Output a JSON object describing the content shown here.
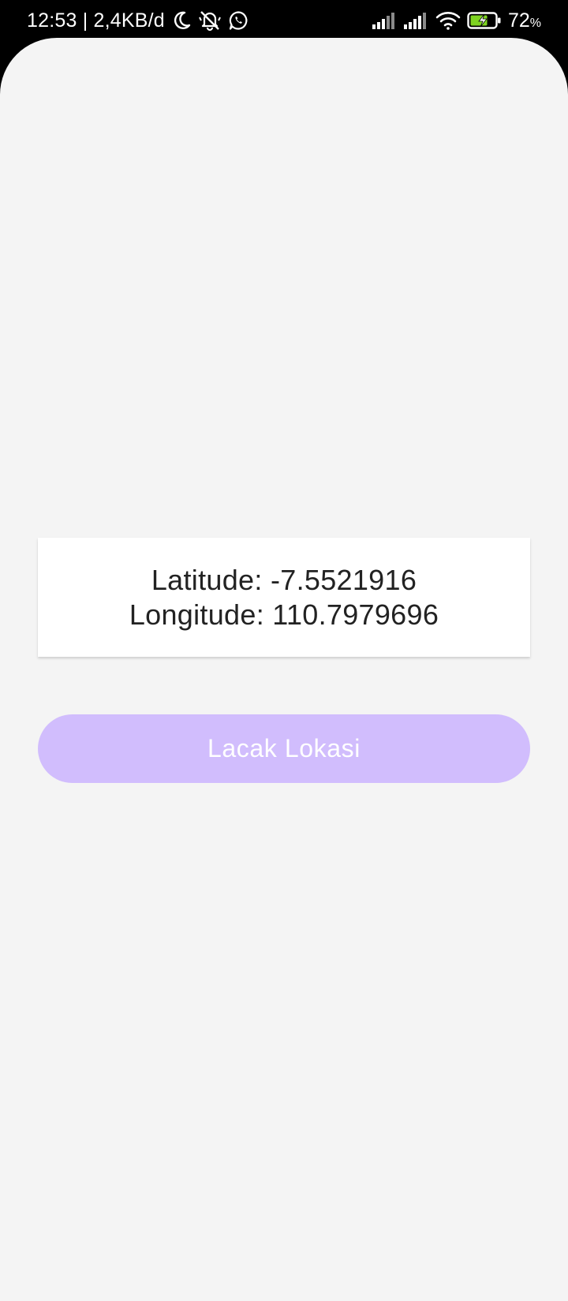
{
  "status_bar": {
    "time_speed": "12:53 | 2,4KB/d",
    "battery_percent": "72",
    "battery_unit": "%",
    "icons": [
      "moon-icon",
      "bell-off-icon",
      "whatsapp-icon",
      "signal-icon",
      "signal-icon",
      "wifi-icon",
      "battery-charging-icon"
    ]
  },
  "location": {
    "latitude_text": "Latitude: -7.5521916",
    "longitude_text": "Longitude: 110.7979696"
  },
  "actions": {
    "track_label": "Lacak Lokasi",
    "button_color": "#d1bdfd"
  },
  "colors": {
    "background": "#f4f4f4",
    "card": "#ffffff",
    "text": "#222222"
  }
}
